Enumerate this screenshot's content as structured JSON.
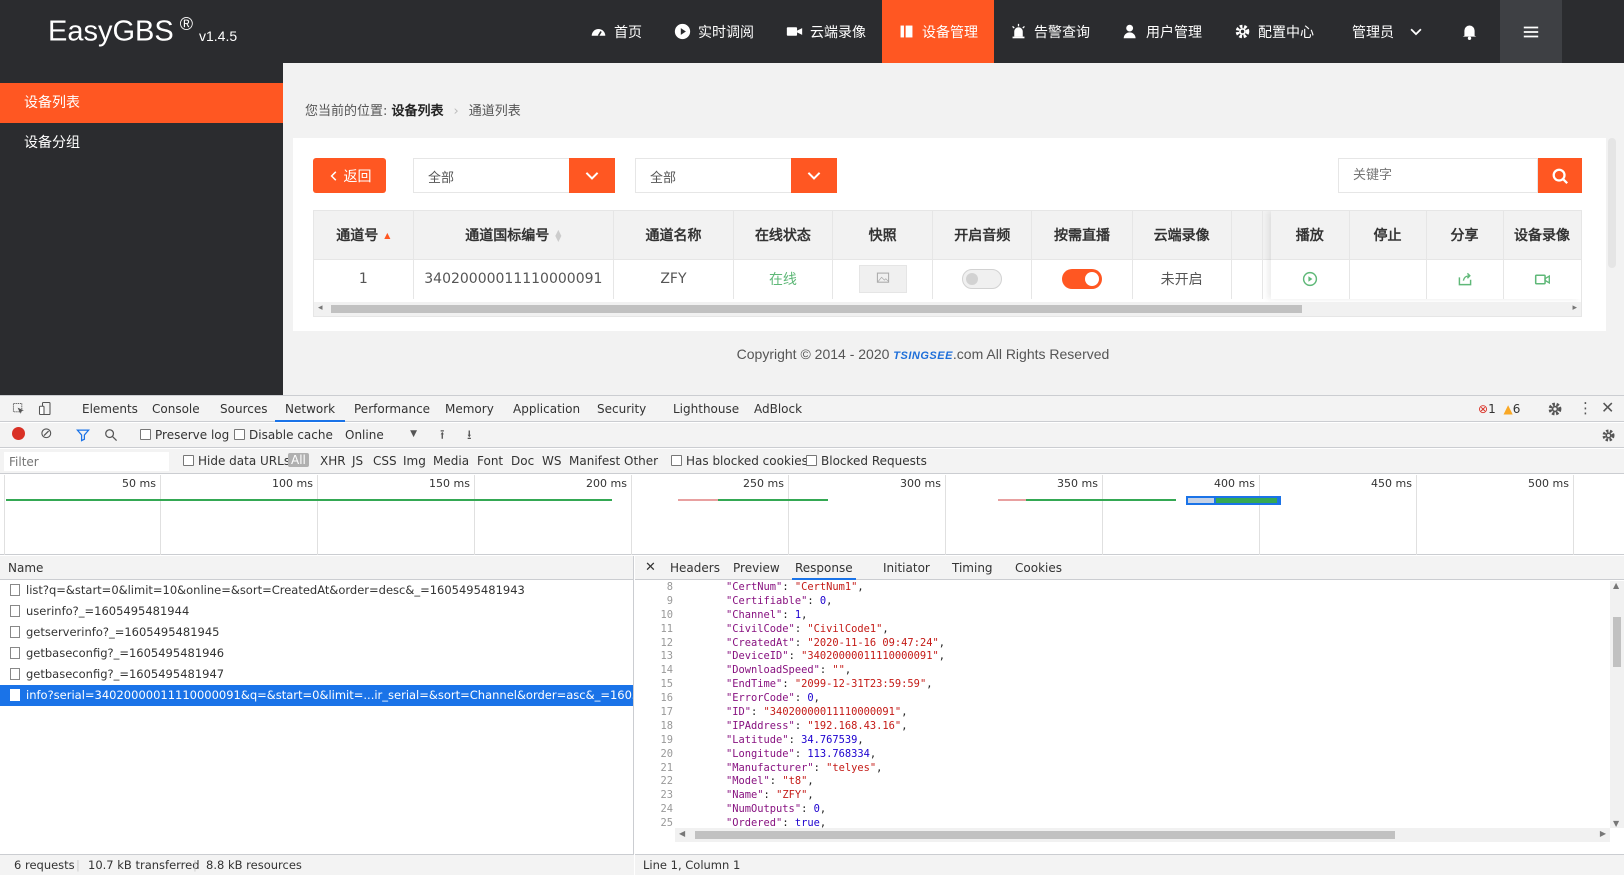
{
  "app": {
    "name": "EasyGBS",
    "reg": "®",
    "version": "v1.4.5"
  },
  "nav": [
    {
      "label": "首页",
      "icon": "dashboard-icon",
      "active": false
    },
    {
      "label": "实时调阅",
      "icon": "play-icon",
      "active": false
    },
    {
      "label": "云端录像",
      "icon": "video-camera-icon",
      "active": false
    },
    {
      "label": "设备管理",
      "icon": "device-grid-icon",
      "active": true
    },
    {
      "label": "告警查询",
      "icon": "alarm-icon",
      "active": false
    },
    {
      "label": "用户管理",
      "icon": "user-icon",
      "active": false
    },
    {
      "label": "配置中心",
      "icon": "gear-icon",
      "active": false
    }
  ],
  "user": {
    "label": "管理员"
  },
  "sidebar": {
    "items": [
      {
        "label": "设备列表",
        "active": true
      },
      {
        "label": "设备分组",
        "active": false
      }
    ]
  },
  "breadcrumb": {
    "prefix": "您当前的位置:",
    "parent": "设备列表",
    "current": "通道列表"
  },
  "toolbar": {
    "back_label": "返回",
    "select1": "全部",
    "select2": "全部",
    "search_placeholder": "关键字"
  },
  "table": {
    "columns": [
      "通道号",
      "通道国标编号",
      "通道名称",
      "在线状态",
      "快照",
      "开启音频",
      "按需直播",
      "云端录像",
      "播放",
      "停止",
      "分享",
      "设备录像"
    ],
    "rows": [
      {
        "channel": "1",
        "gb_id": "34020000011110000091",
        "name": "ZFY",
        "online": "在线",
        "audio": false,
        "on_demand": true,
        "cloud_record": "未开启"
      }
    ]
  },
  "footer": {
    "prefix": "Copyright © 2014 - 2020 ",
    "brand": "TSINGSEE",
    "suffix": ".com All Rights Reserved"
  },
  "devtools": {
    "tabs": [
      "Elements",
      "Console",
      "Sources",
      "Network",
      "Performance",
      "Memory",
      "Application",
      "Security",
      "Lighthouse",
      "AdBlock"
    ],
    "active_tab": "Network",
    "errors": "1",
    "warnings": "6",
    "toolbar": {
      "preserve_log": "Preserve log",
      "disable_cache": "Disable cache",
      "throttle": "Online"
    },
    "filter": {
      "placeholder": "Filter",
      "hide_data_urls": "Hide data URLs",
      "types": [
        "All",
        "XHR",
        "JS",
        "CSS",
        "Img",
        "Media",
        "Font",
        "Doc",
        "WS",
        "Manifest",
        "Other"
      ],
      "has_blocked_cookies": "Has blocked cookies",
      "blocked_requests": "Blocked Requests"
    },
    "timeline_ticks": [
      "50 ms",
      "100 ms",
      "150 ms",
      "200 ms",
      "250 ms",
      "300 ms",
      "350 ms",
      "400 ms",
      "450 ms",
      "500 ms"
    ],
    "names_header": "Name",
    "requests": [
      "list?q=&start=0&limit=10&online=&sort=CreatedAt&order=desc&_=1605495481943",
      "userinfo?_=1605495481944",
      "getserverinfo?_=1605495481945",
      "getbaseconfig?_=1605495481946",
      "getbaseconfig?_=1605495481947",
      "info?serial=34020000011110000091&q=&start=0&limit=...ir_serial=&sort=Channel&order=asc&_=1605495481..."
    ],
    "selected_request": 5,
    "status": {
      "requests": "6 requests",
      "transferred": "10.7 kB transferred",
      "resources": "8.8 kB resources"
    },
    "detail_tabs": [
      "Headers",
      "Preview",
      "Response",
      "Initiator",
      "Timing",
      "Cookies"
    ],
    "detail_active": "Response",
    "response_lines": [
      {
        "ln": "8",
        "key": "CertNum",
        "val": "\"CertNum1\""
      },
      {
        "ln": "9",
        "key": "Certifiable",
        "val": "0"
      },
      {
        "ln": "10",
        "key": "Channel",
        "val": "1"
      },
      {
        "ln": "11",
        "key": "CivilCode",
        "val": "\"CivilCode1\""
      },
      {
        "ln": "12",
        "key": "CreatedAt",
        "val": "\"2020-11-16 09:47:24\""
      },
      {
        "ln": "13",
        "key": "DeviceID",
        "val": "\"34020000011110000091\""
      },
      {
        "ln": "14",
        "key": "DownloadSpeed",
        "val": "\"\""
      },
      {
        "ln": "15",
        "key": "EndTime",
        "val": "\"2099-12-31T23:59:59\""
      },
      {
        "ln": "16",
        "key": "ErrorCode",
        "val": "0"
      },
      {
        "ln": "17",
        "key": "ID",
        "val": "\"34020000011110000091\""
      },
      {
        "ln": "18",
        "key": "IPAddress",
        "val": "\"192.168.43.16\""
      },
      {
        "ln": "19",
        "key": "Latitude",
        "val": "34.767539"
      },
      {
        "ln": "20",
        "key": "Longitude",
        "val": "113.768334"
      },
      {
        "ln": "21",
        "key": "Manufacturer",
        "val": "\"telyes\""
      },
      {
        "ln": "22",
        "key": "Model",
        "val": "\"t8\""
      },
      {
        "ln": "23",
        "key": "Name",
        "val": "\"ZFY\""
      },
      {
        "ln": "24",
        "key": "NumOutputs",
        "val": "0"
      },
      {
        "ln": "25",
        "key": "Ordered",
        "val": "true"
      }
    ],
    "cursor_status": "Line 1, Column 1"
  }
}
